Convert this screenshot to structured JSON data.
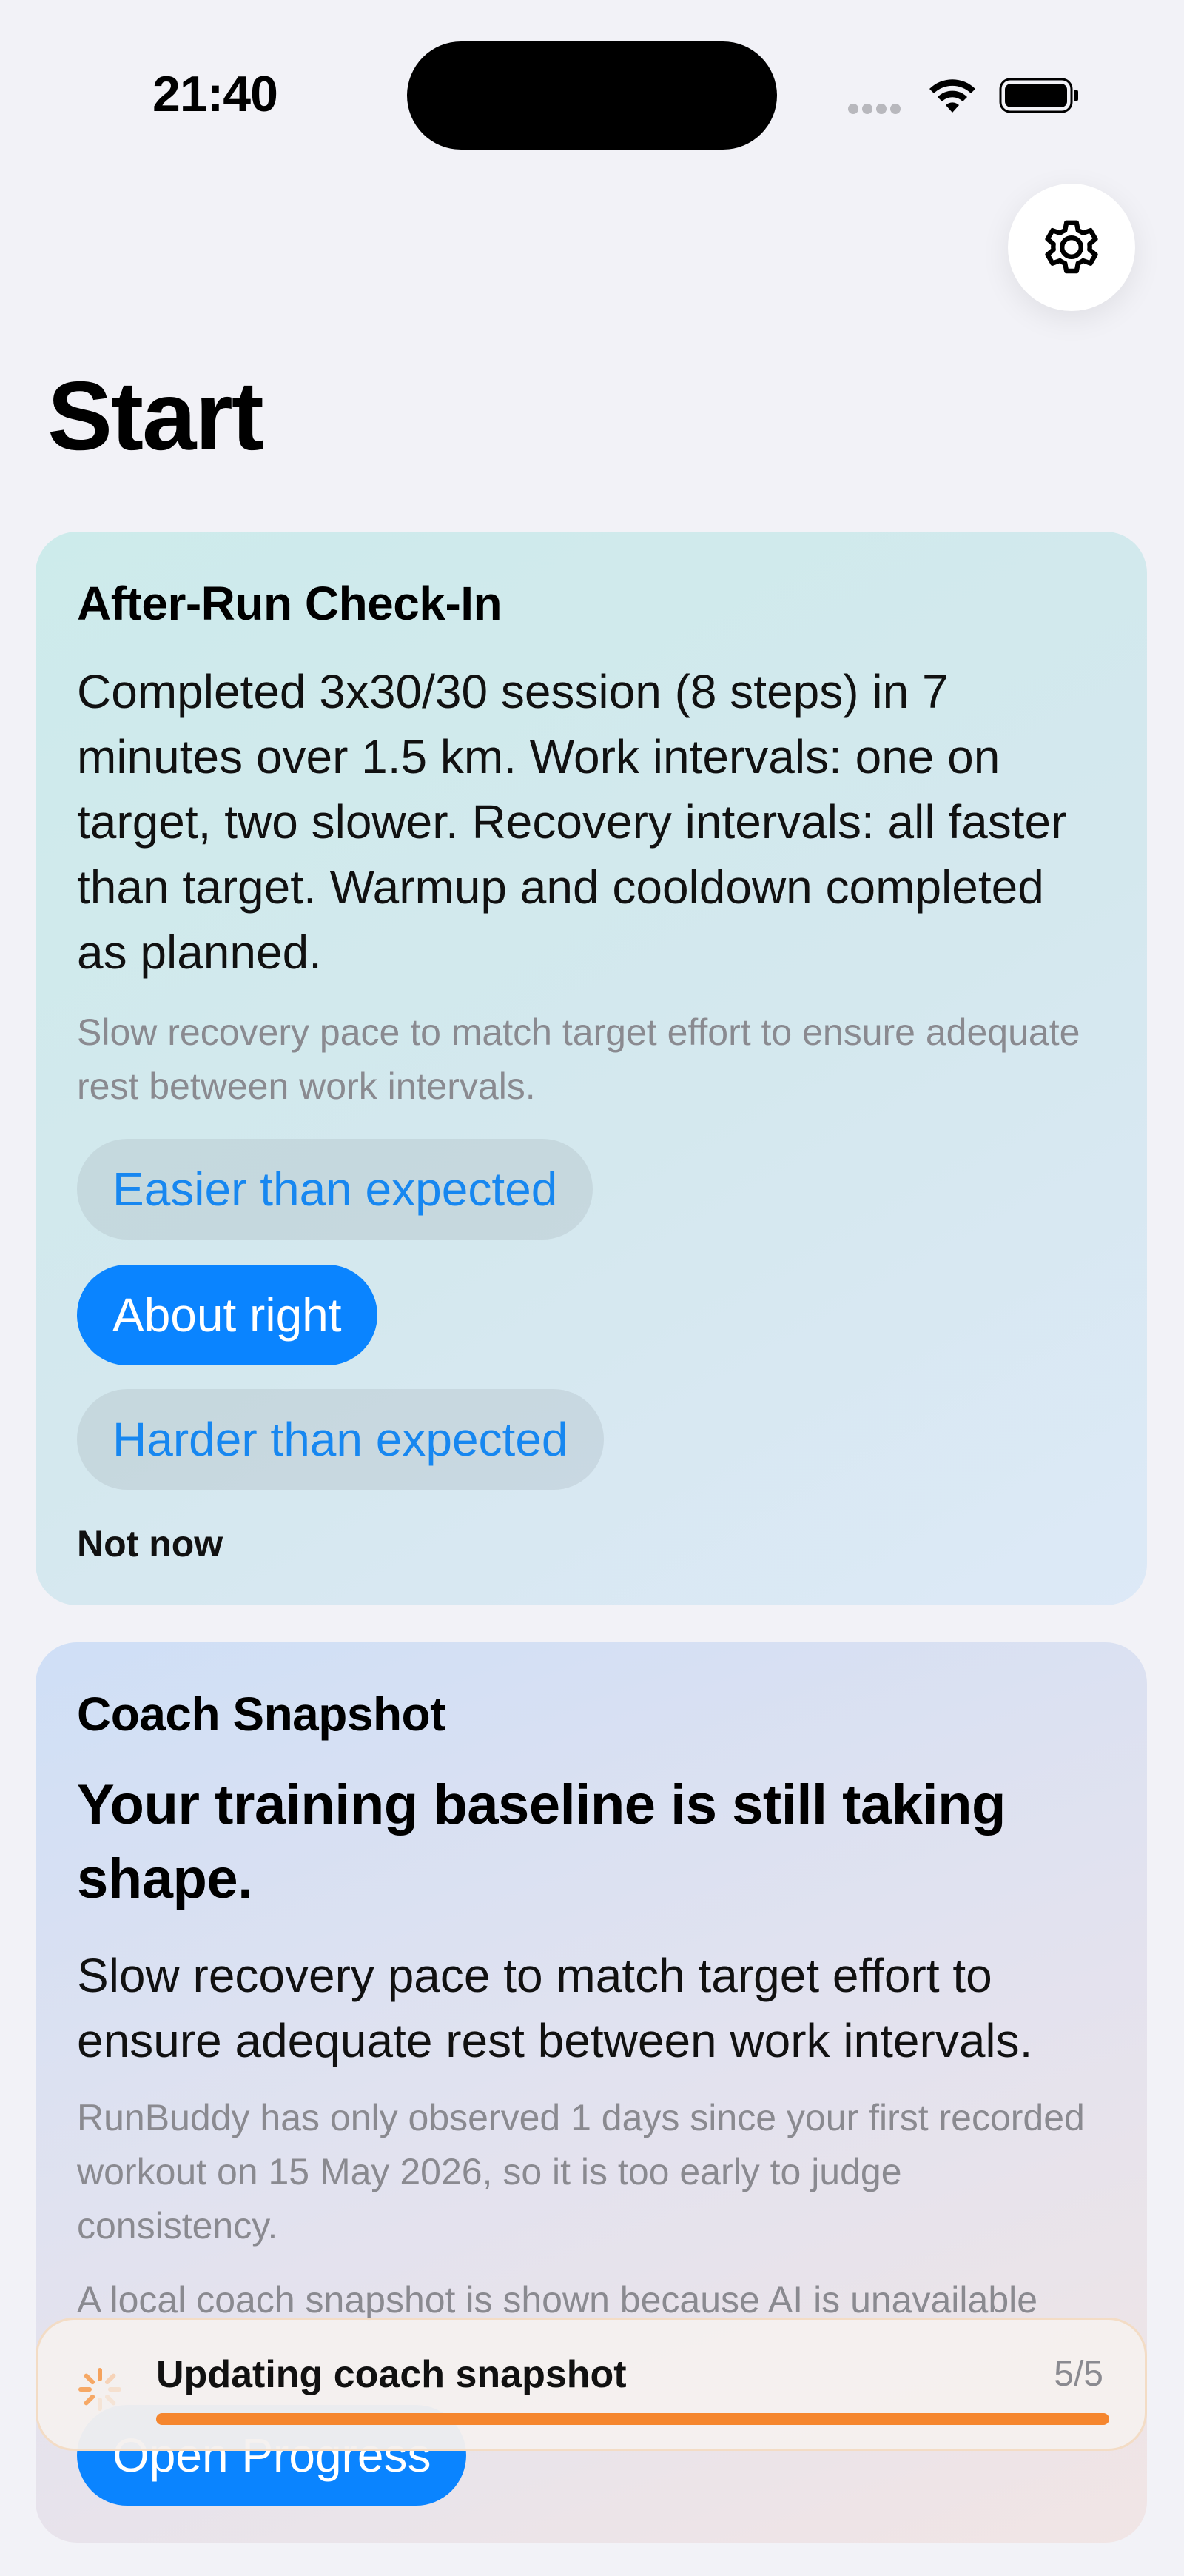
{
  "status_bar": {
    "time": "21:40"
  },
  "page": {
    "title": "Start"
  },
  "checkin": {
    "heading": "After-Run Check-In",
    "summary": "Completed 3x30/30 session (8 steps) in 7 minutes over 1.5 km. Work intervals: one on target, two slower. Recovery intervals: all faster than target. Warmup and cooldown completed as planned.",
    "hint": "Slow recovery pace to match target effort to ensure adequate rest between work intervals.",
    "options": [
      {
        "label": "Easier than expected",
        "selected": false
      },
      {
        "label": "About right",
        "selected": true
      },
      {
        "label": "Harder than expected",
        "selected": false
      }
    ],
    "dismiss_label": "Not now"
  },
  "snapshot": {
    "heading": "Coach Snapshot",
    "headline": "Your training baseline is still taking shape.",
    "advice": "Slow recovery pace to match target effort to ensure adequate rest between work intervals.",
    "detail": "RunBuddy has only observed 1 days since your first recorded workout on 15 May 2026, so it is too early to judge consistency.",
    "note": "A local coach snapshot is shown because AI is unavailable",
    "action_label": "Open Progress"
  },
  "toast": {
    "label": "Updating coach snapshot",
    "count": "5/5",
    "progress": 1.0
  },
  "colors": {
    "accent": "#0a84ff",
    "progress": "#f5862e",
    "background": "#f2f2f7"
  }
}
